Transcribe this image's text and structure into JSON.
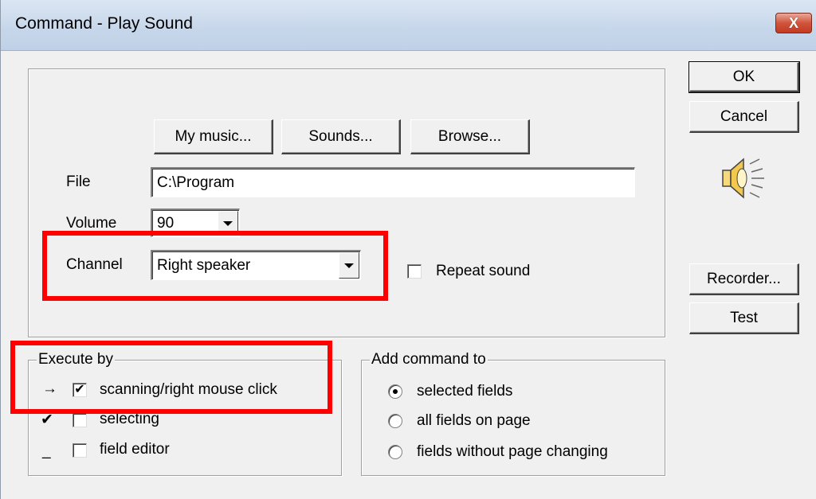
{
  "window": {
    "title": "Command - Play Sound",
    "close_label": "X"
  },
  "buttons": {
    "ok": "OK",
    "cancel": "Cancel",
    "my_music": "My music...",
    "sounds": "Sounds...",
    "browse": "Browse...",
    "recorder": "Recorder...",
    "test": "Test"
  },
  "form": {
    "file_label": "File",
    "file_value": "C:\\Program",
    "volume_label": "Volume",
    "volume_value": "90",
    "channel_label": "Channel",
    "channel_value": "Right speaker",
    "repeat_label": "Repeat sound",
    "repeat_checked": false
  },
  "execute_by": {
    "title": "Execute by",
    "items": [
      {
        "marker": "→",
        "label": "scanning/right mouse click",
        "checked": true
      },
      {
        "marker": "✔",
        "label": "selecting",
        "checked": false
      },
      {
        "marker": "_",
        "label": "field editor",
        "checked": false
      }
    ]
  },
  "add_command_to": {
    "title": "Add command to",
    "options": [
      {
        "label": "selected fields",
        "selected": true
      },
      {
        "label": "all fields on page",
        "selected": false
      },
      {
        "label": "fields without page changing",
        "selected": false
      }
    ]
  },
  "icons": {
    "speaker": "speaker-icon"
  },
  "colors": {
    "highlight": "#ff0000",
    "dialog_bg": "#f0f0f0"
  }
}
